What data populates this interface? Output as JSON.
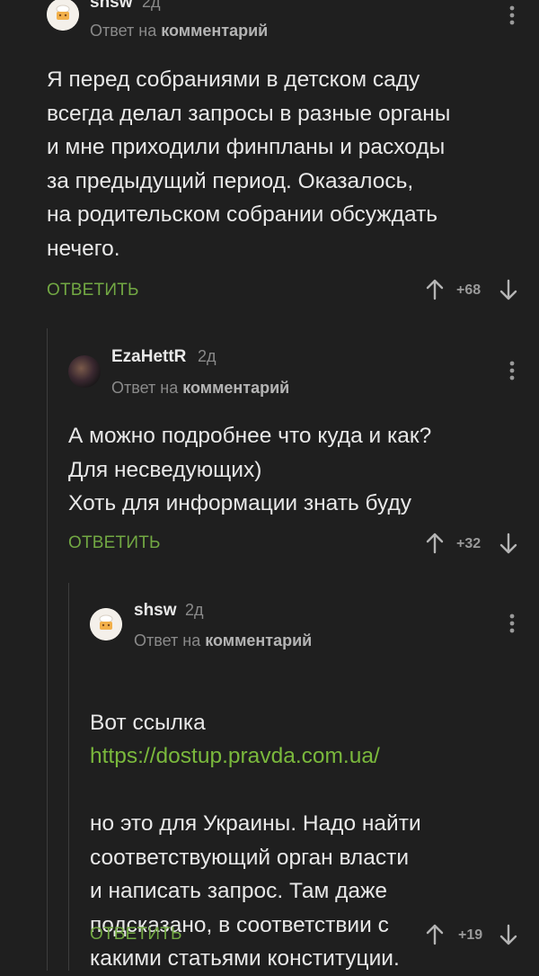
{
  "comments": [
    {
      "username": "shsw",
      "time": "2д",
      "reply_prefix": "Ответ на",
      "reply_target": "комментарий",
      "paragraphs": [
        "Я перед собраниями в детском саду\nвсегда делал запросы в разные органы\nи мне приходили финпланы и расходы\nза предыдущий период. Оказалось,\nна родительском собрании обсуждать\nнечего."
      ],
      "reply_label": "ОТВЕТИТЬ",
      "rating": "+68"
    },
    {
      "username": "EzaHettR",
      "time": "2д",
      "reply_prefix": "Ответ на",
      "reply_target": "комментарий",
      "paragraphs": [
        "А можно подробнее что куда и как?\nДля несведующих)\nХоть для информации знать буду"
      ],
      "reply_label": "ОТВЕТИТЬ",
      "rating": "+32"
    },
    {
      "username": "shsw",
      "time": "2д",
      "reply_prefix": "Ответ на",
      "reply_target": "комментарий",
      "line_before_link": "Вот ссылка",
      "link": "https://dostup.pravda.com.ua/",
      "paragraphs": [
        "но это для Украины. Надо найти\nсоответствующий орган власти\nи написать запрос. Там даже\nподсказано, в соответствии с\nкакими статьями конституции."
      ],
      "reply_label": "ОТВЕТИТЬ",
      "rating": "+19"
    }
  ],
  "colors": {
    "background": "#1f1f1f",
    "link": "#7ab83c",
    "reply": "#72a843",
    "muted": "#8a8a8a"
  },
  "icons": [
    "chef-avatar-icon",
    "more-vertical-icon",
    "arrow-up-icon",
    "arrow-down-icon"
  ]
}
